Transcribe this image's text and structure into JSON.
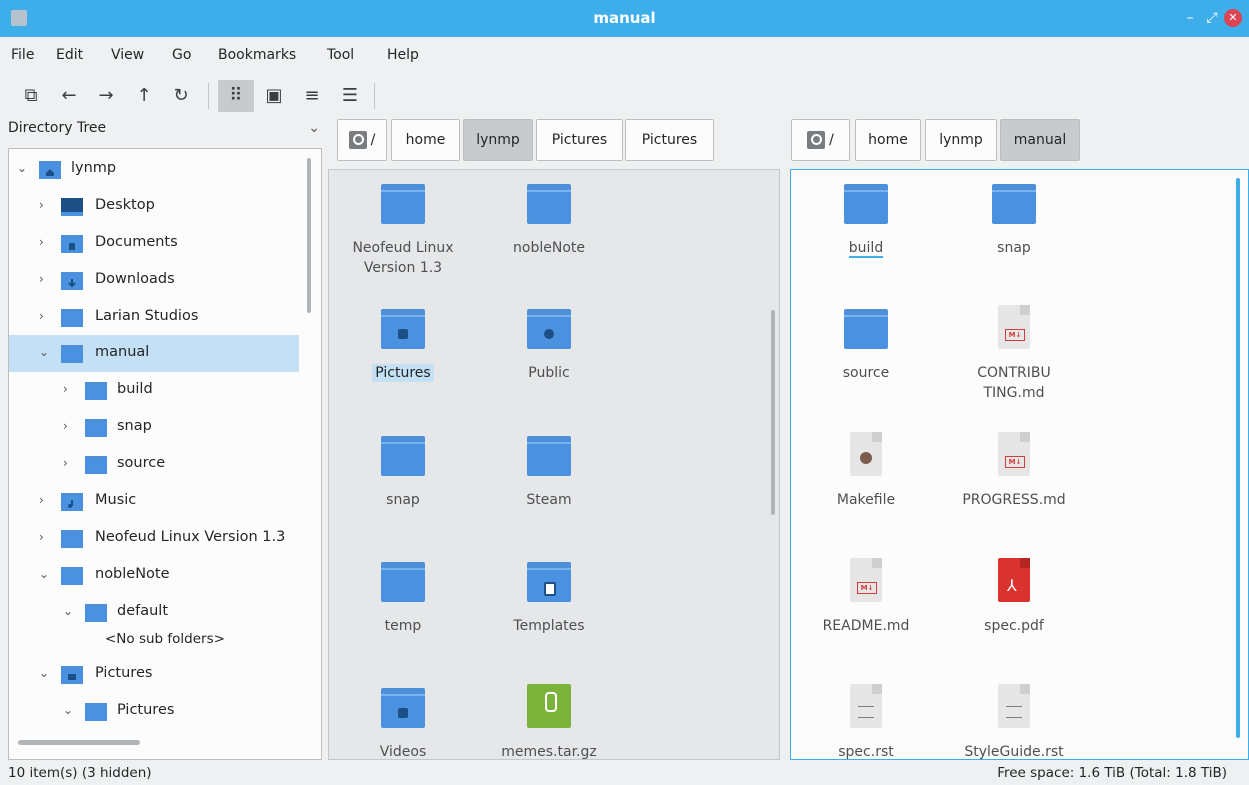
{
  "window": {
    "title": "manual",
    "minimize_glyph": "–",
    "restore_glyph": "⤢",
    "close_glyph": "✕"
  },
  "menu": [
    "File",
    "Edit",
    "View",
    "Go",
    "Bookmarks",
    "Tool",
    "Help"
  ],
  "toolbar": [
    {
      "icon": "new-tab-icon",
      "glyph": "⧉"
    },
    {
      "icon": "back-arrow-icon",
      "glyph": "←"
    },
    {
      "icon": "forward-arrow-icon",
      "glyph": "→"
    },
    {
      "icon": "up-arrow-icon",
      "glyph": "↑"
    },
    {
      "icon": "reload-icon",
      "glyph": "↻"
    },
    {
      "icon": "icon-view-icon",
      "glyph": "⠿",
      "active": true
    },
    {
      "icon": "thumbnail-view-icon",
      "glyph": "▣"
    },
    {
      "icon": "compact-view-icon",
      "glyph": "≡"
    },
    {
      "icon": "detailed-list-view-icon",
      "glyph": "☰"
    }
  ],
  "sidebar": {
    "title": "Directory Tree",
    "chevron": "⌄",
    "items": [
      {
        "label": "lynmp",
        "level": 0,
        "expanded": true
      },
      {
        "label": "Desktop",
        "level": 1,
        "expanded": false
      },
      {
        "label": "Documents",
        "level": 1,
        "expanded": false
      },
      {
        "label": "Downloads",
        "level": 1,
        "expanded": false
      },
      {
        "label": "Larian Studios",
        "level": 1,
        "expanded": false
      },
      {
        "label": "manual",
        "level": 1,
        "expanded": true,
        "selected": true
      },
      {
        "label": "build",
        "level": 2,
        "expanded": false
      },
      {
        "label": "snap",
        "level": 2,
        "expanded": false
      },
      {
        "label": "source",
        "level": 2,
        "expanded": false
      },
      {
        "label": "Music",
        "level": 1,
        "expanded": false
      },
      {
        "label": "Neofeud Linux Version 1.3",
        "level": 1,
        "expanded": false
      },
      {
        "label": "nobleNote",
        "level": 1,
        "expanded": true
      },
      {
        "label": "default",
        "level": 2,
        "expanded": true
      },
      {
        "label": "<No sub folders>",
        "level": 3,
        "placeholder": true
      },
      {
        "label": "Pictures",
        "level": 1,
        "expanded": true
      },
      {
        "label": "Pictures",
        "level": 2,
        "expanded": true
      }
    ]
  },
  "left_pane": {
    "root_label": "/",
    "crumbs": [
      {
        "label": "home",
        "active": false
      },
      {
        "label": "lynmp",
        "active": true
      },
      {
        "label": "Pictures",
        "active": false
      },
      {
        "label": "Pictures",
        "active": false
      }
    ],
    "items": [
      {
        "name": "Neofeud Linux Version 1.3",
        "kind": "folder"
      },
      {
        "name": "nobleNote",
        "kind": "folder"
      },
      {
        "name": "Pictures",
        "kind": "folder-pictures",
        "selected": true
      },
      {
        "name": "Public",
        "kind": "folder-public"
      },
      {
        "name": "snap",
        "kind": "folder"
      },
      {
        "name": "Steam",
        "kind": "folder"
      },
      {
        "name": "temp",
        "kind": "folder"
      },
      {
        "name": "Templates",
        "kind": "folder-templates"
      },
      {
        "name": "Videos",
        "kind": "folder-videos"
      },
      {
        "name": "memes.tar.gz",
        "kind": "archive"
      }
    ]
  },
  "right_pane": {
    "root_label": "/",
    "crumbs": [
      {
        "label": "home",
        "active": false
      },
      {
        "label": "lynmp",
        "active": false
      },
      {
        "label": "manual",
        "active": true
      }
    ],
    "items": [
      {
        "name": "build",
        "kind": "folder",
        "current": true
      },
      {
        "name": "snap",
        "kind": "folder"
      },
      {
        "name": "source",
        "kind": "folder"
      },
      {
        "name": "CONTRIBUTING.md",
        "kind": "markdown"
      },
      {
        "name": "Makefile",
        "kind": "makefile"
      },
      {
        "name": "PROGRESS.md",
        "kind": "markdown"
      },
      {
        "name": "README.md",
        "kind": "markdown"
      },
      {
        "name": "spec.pdf",
        "kind": "pdf"
      },
      {
        "name": "spec.rst",
        "kind": "text"
      },
      {
        "name": "StyleGuide.rst",
        "kind": "text"
      }
    ]
  },
  "status": {
    "left": "10 item(s) (3 hidden)",
    "right": "Free space: 1.6 TiB (Total: 1.8 TiB)"
  },
  "colors": {
    "accent": "#3daee9",
    "folder": "#4a91e0",
    "selection": "#c3e0f5",
    "close_button": "#da4453"
  }
}
